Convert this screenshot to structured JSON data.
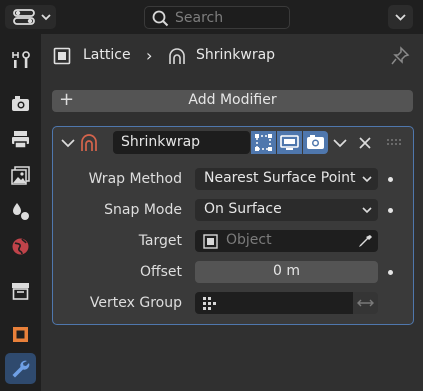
{
  "header": {
    "search_placeholder": "Search"
  },
  "breadcrumb": {
    "object": "Lattice",
    "separator": "›",
    "modifier": "Shrinkwrap"
  },
  "toolbar": {
    "add_modifier_label": "Add Modifier",
    "add_modifier_symbol": "+"
  },
  "modifier": {
    "name": "Shrinkwrap",
    "fields": {
      "wrap_method": {
        "label": "Wrap Method",
        "value": "Nearest Surface Point"
      },
      "snap_mode": {
        "label": "Snap Mode",
        "value": "On Surface"
      },
      "target": {
        "label": "Target",
        "placeholder": "Object"
      },
      "offset": {
        "label": "Offset",
        "value": "0 m"
      },
      "vertex_group": {
        "label": "Vertex Group",
        "value": ""
      }
    }
  },
  "colors": {
    "accent": "#4f77ad",
    "modifier_icon": "#d6644c",
    "panel_bg": "#303030",
    "strip_bg": "#1f1f1f"
  },
  "tabs": [
    {
      "name": "tool",
      "icon": "tool-icon"
    },
    {
      "name": "render",
      "icon": "render-icon"
    },
    {
      "name": "output",
      "icon": "output-icon"
    },
    {
      "name": "view-layer",
      "icon": "image-icon"
    },
    {
      "name": "scene",
      "icon": "scene-icon"
    },
    {
      "name": "world",
      "icon": "world-icon"
    },
    {
      "name": "collection",
      "icon": "collection-icon"
    },
    {
      "name": "object",
      "icon": "object-icon"
    },
    {
      "name": "modifiers",
      "icon": "wrench-icon",
      "active": true
    }
  ]
}
